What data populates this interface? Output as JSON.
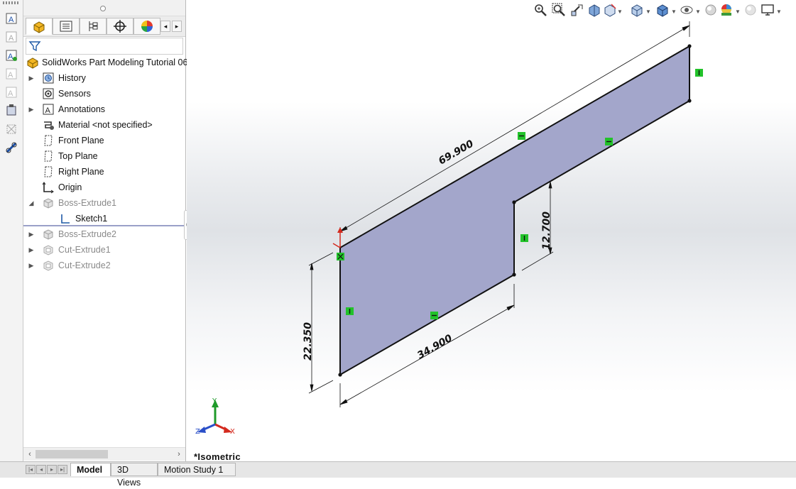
{
  "feature_manager": {
    "tabs": [
      "feature-manager-tab",
      "property-manager-tab",
      "configuration-manager-tab",
      "dimxpert-tab",
      "display-manager-tab"
    ],
    "tree": {
      "root": "SolidWorks Part Modeling Tutorial 06",
      "items": [
        {
          "label": "History",
          "expandable": true,
          "icon": "history-icon",
          "dim": false
        },
        {
          "label": "Sensors",
          "expandable": false,
          "icon": "sensors-icon",
          "dim": false
        },
        {
          "label": "Annotations",
          "expandable": true,
          "icon": "annotations-icon",
          "dim": false
        },
        {
          "label": "Material <not specified>",
          "expandable": false,
          "icon": "material-icon",
          "dim": false
        },
        {
          "label": "Front Plane",
          "expandable": false,
          "icon": "plane-icon",
          "dim": false
        },
        {
          "label": "Top Plane",
          "expandable": false,
          "icon": "plane-icon",
          "dim": false
        },
        {
          "label": "Right Plane",
          "expandable": false,
          "icon": "plane-icon",
          "dim": false
        },
        {
          "label": "Origin",
          "expandable": false,
          "icon": "origin-icon",
          "dim": false
        },
        {
          "label": "Boss-Extrude1",
          "expandable": true,
          "expanded": true,
          "icon": "extrude-icon",
          "dim": true
        },
        {
          "label": "Sketch1",
          "expandable": false,
          "icon": "sketch-icon",
          "dim": false,
          "child": true
        },
        {
          "label": "Boss-Extrude2",
          "expandable": true,
          "icon": "extrude-icon",
          "dim": true
        },
        {
          "label": "Cut-Extrude1",
          "expandable": true,
          "icon": "cut-extrude-icon",
          "dim": true
        },
        {
          "label": "Cut-Extrude2",
          "expandable": true,
          "icon": "cut-extrude-icon",
          "dim": true
        }
      ]
    }
  },
  "bottom_tabs": [
    "Model",
    "3D Views",
    "Motion Study 1"
  ],
  "viewport": {
    "view_name": "*Isometric",
    "dimensions": {
      "top_length": "69.900",
      "bottom_length": "34.900",
      "left_height": "22.350",
      "step_height": "12.700"
    },
    "triad": {
      "x": "X",
      "y": "Y",
      "z": "Z"
    }
  },
  "colors": {
    "sketch_fill": "#a3a6cb",
    "relation_green": "#22c22a",
    "axis_x": "#d42a1e",
    "axis_y": "#1f9a2a",
    "axis_z": "#2a4fc8"
  }
}
